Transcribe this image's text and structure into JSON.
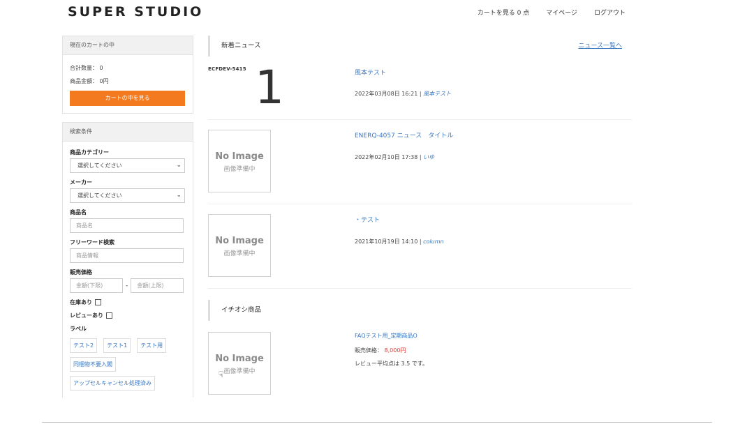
{
  "header": {
    "logo": "SUPER STUDIO",
    "nav": [
      "カートを見る 0 点",
      "マイページ",
      "ログアウト"
    ]
  },
  "cart": {
    "title": "現在のカートの中",
    "qty_label": "合計数量： 0",
    "amount_label": "商品金額： 0円",
    "button": "カートの中を見る"
  },
  "search": {
    "title": "検索条件",
    "category_label": "商品カテゴリー",
    "category_value": "選択してください",
    "maker_label": "メーカー",
    "maker_value": "選択してください",
    "name_label": "商品名",
    "name_placeholder": "商品名",
    "freeword_label": "フリーワード検索",
    "freeword_placeholder": "商品情報",
    "price_label": "販売価格",
    "price_min_placeholder": "金額(下限)",
    "price_sep": "-",
    "price_max_placeholder": "金額(上限)",
    "stock_label": "在庫あり",
    "review_label": "レビューあり",
    "label_label": "ラベル",
    "tags": [
      "テスト2",
      "テスト1",
      "テスト用",
      "同梱物不要入閣",
      "アップセルキャンセル処理済み"
    ]
  },
  "news": {
    "title": "新着ニュース",
    "more": "ニュース一覧へ",
    "thumb_text": "ECFDEV-5415",
    "thumb_big": "1",
    "no_image": "No Image",
    "no_image_sub": "画像準備中",
    "items": [
      {
        "title": "風本テスト",
        "date": "2022年03月08日 16:21 |",
        "category": "風本テスト"
      },
      {
        "title": "ENERQ-4057 ニュース　タイトル",
        "date": "2022年02月10日 17:38 |",
        "category": "いゆ"
      },
      {
        "title": "・テスト",
        "date": "2021年10月19日 14:10 |",
        "category": "column"
      }
    ]
  },
  "featured": {
    "title": "イチオシ商品",
    "product": {
      "name": "FAQテスト用_定期商品O",
      "price_label": "販売価格：",
      "price_value": "8,000円",
      "review": "レビュー平均点は 3.5 です。"
    }
  }
}
